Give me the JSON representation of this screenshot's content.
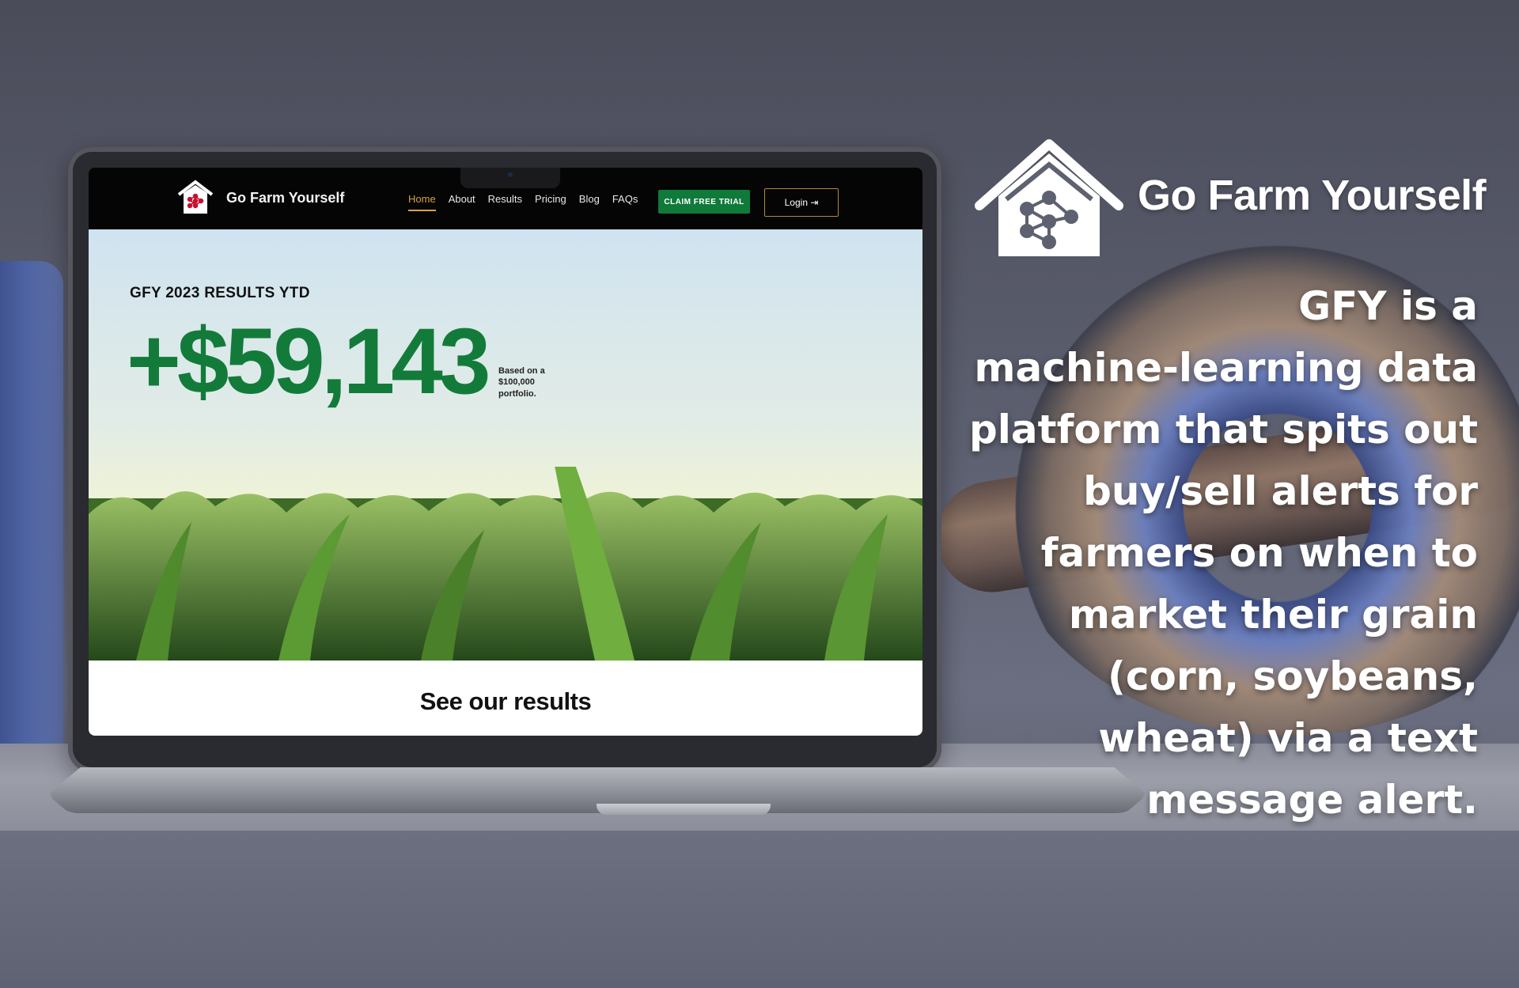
{
  "site": {
    "brand": "Go Farm Yourself",
    "nav": [
      "Home",
      "About",
      "Results",
      "Pricing",
      "Blog",
      "FAQs"
    ],
    "active_nav": "Home",
    "cta_label": "CLAIM FREE TRIAL",
    "login_label": "Login ⇥"
  },
  "hero": {
    "eyebrow": "GFY 2023 RESULTS YTD",
    "amount": "+$59,143",
    "note": "Based on a $100,000 portfolio."
  },
  "results": {
    "heading": "See our results"
  },
  "marketing": {
    "brand": "Go Farm Yourself",
    "copy": "GFY is a\nmachine-learning data\nplatform that spits out\nbuy/sell alerts for\nfarmers on when to\nmarket their grain\n(corn, soybeans,\nwheat) via a text\nmessage alert."
  },
  "colors": {
    "accent_green": "#137b3a",
    "nav_active": "#d9a441",
    "cta_green": "#0f7a3a"
  },
  "icons": {
    "logo": "barn-network-icon"
  }
}
